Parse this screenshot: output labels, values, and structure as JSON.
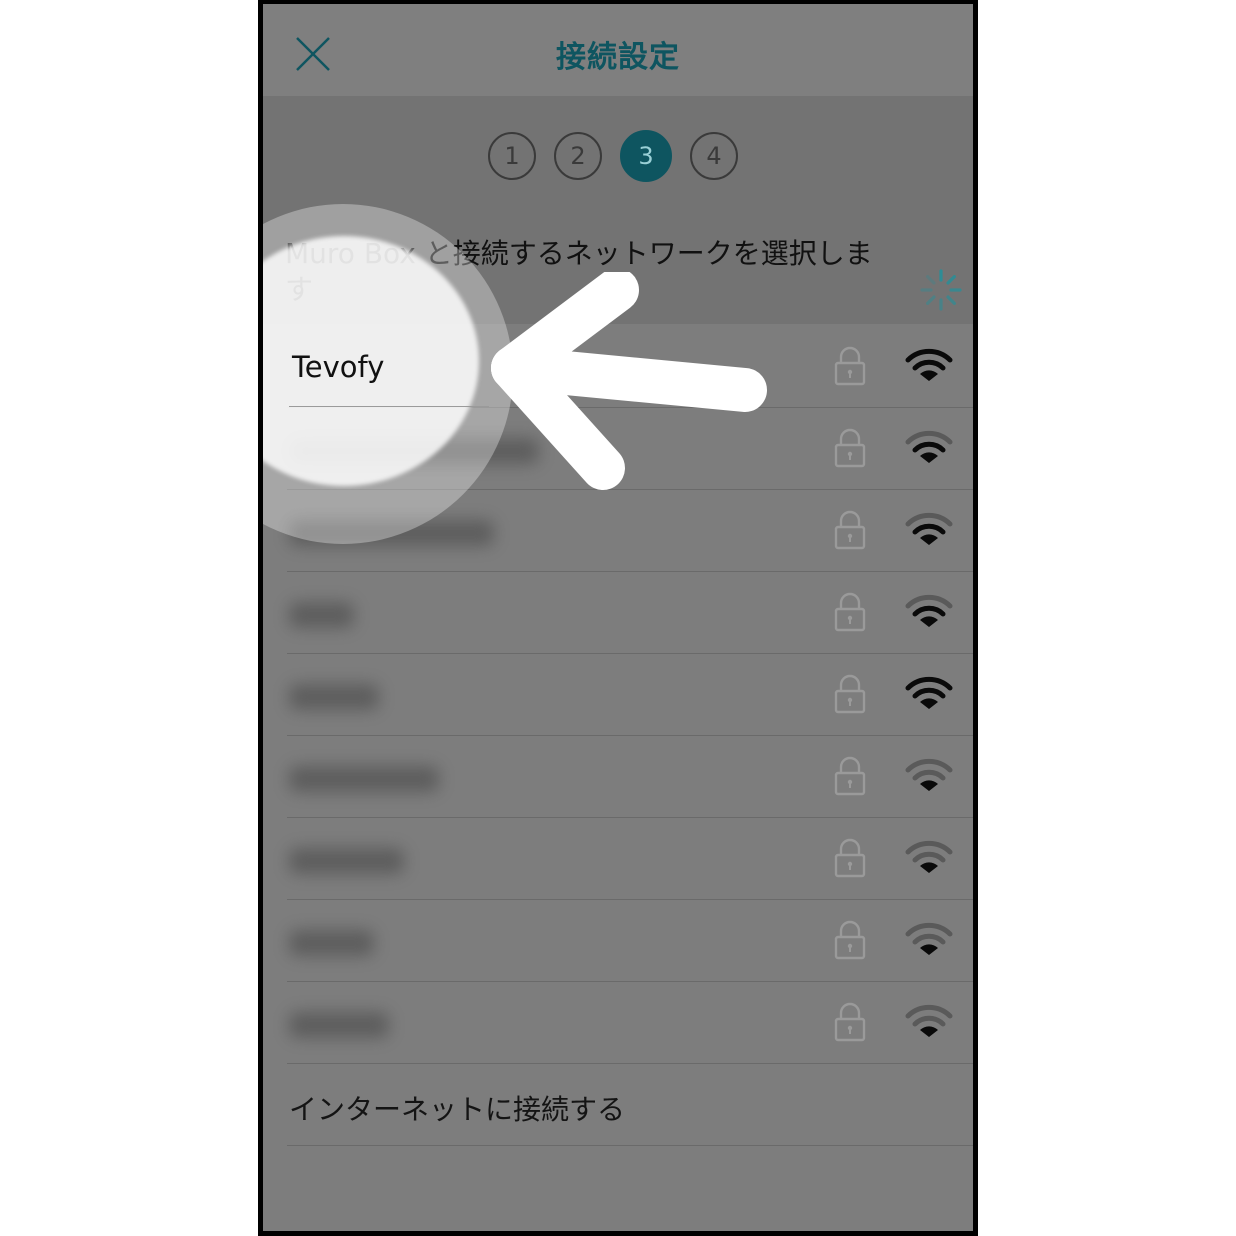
{
  "navbar": {
    "title": "接続設定",
    "close_icon": "close-icon"
  },
  "steps": [
    "1",
    "2",
    "3",
    "4"
  ],
  "active_step": 3,
  "instruction": "Muro Box と接続するネットワークを選択します",
  "loading_icon": "spinner-icon",
  "networks": [
    {
      "name": "Tevofy",
      "secured": true,
      "signal": "strong"
    },
    {
      "name": "",
      "secured": true,
      "signal": "medium"
    },
    {
      "name": "",
      "secured": true,
      "signal": "medium"
    },
    {
      "name": "",
      "secured": true,
      "signal": "medium"
    },
    {
      "name": "",
      "secured": true,
      "signal": "strong"
    },
    {
      "name": "",
      "secured": true,
      "signal": "weak"
    },
    {
      "name": "",
      "secured": true,
      "signal": "weak"
    },
    {
      "name": "",
      "secured": true,
      "signal": "weak"
    },
    {
      "name": "",
      "secured": true,
      "signal": "weak"
    }
  ],
  "internet_option": "インターネットに接続する",
  "colors": {
    "accent": "#0e5560",
    "overlay": "#7d7d7d"
  }
}
